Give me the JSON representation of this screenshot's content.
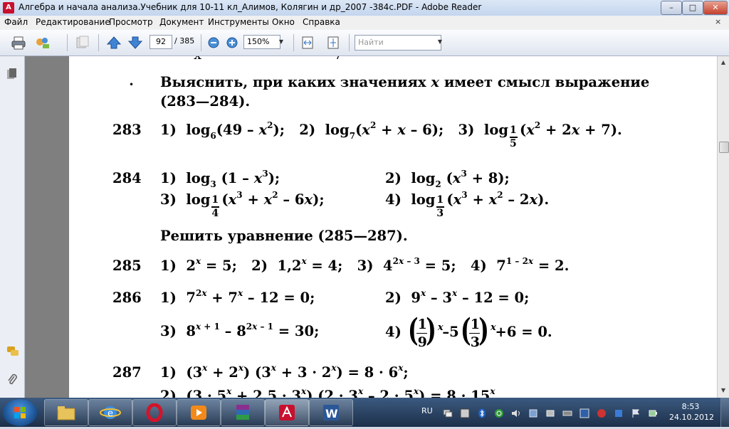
{
  "window": {
    "title": "Алгебра и начала анализа.Учебник для 10-11 кл_Алимов, Колягин и др_2007 -384с.PDF - Adobe Reader",
    "minimize": "–",
    "maximize": "□",
    "close": "✕"
  },
  "menu": {
    "items": [
      "Файл",
      "Редактирование",
      "Просмотр",
      "Документ",
      "Инструменты",
      "Окно",
      "Справка"
    ],
    "doc_close": "×"
  },
  "toolbar": {
    "current_page": "92",
    "total_pages": "/ 385",
    "zoom": "150%",
    "search_placeholder": "Найти"
  },
  "doc": {
    "intro_1": "Выяснить, при каких значениях",
    "intro_var": "x",
    "intro_2": "имеет смысл выражение",
    "intro_range": "(283—284).",
    "solve_heading": "Решить уравнение",
    "solve_range": "(285—287).",
    "problems": [
      "283",
      "284",
      "285",
      "286",
      "287"
    ]
  },
  "taskbar": {
    "language": "RU",
    "time": "8:53",
    "date": "24.10.2012"
  },
  "colors": {
    "titlebar": "#c3d5ee",
    "taskbar": "#1c2f49",
    "document_background": "#7f7f7f",
    "page": "#ffffff"
  }
}
